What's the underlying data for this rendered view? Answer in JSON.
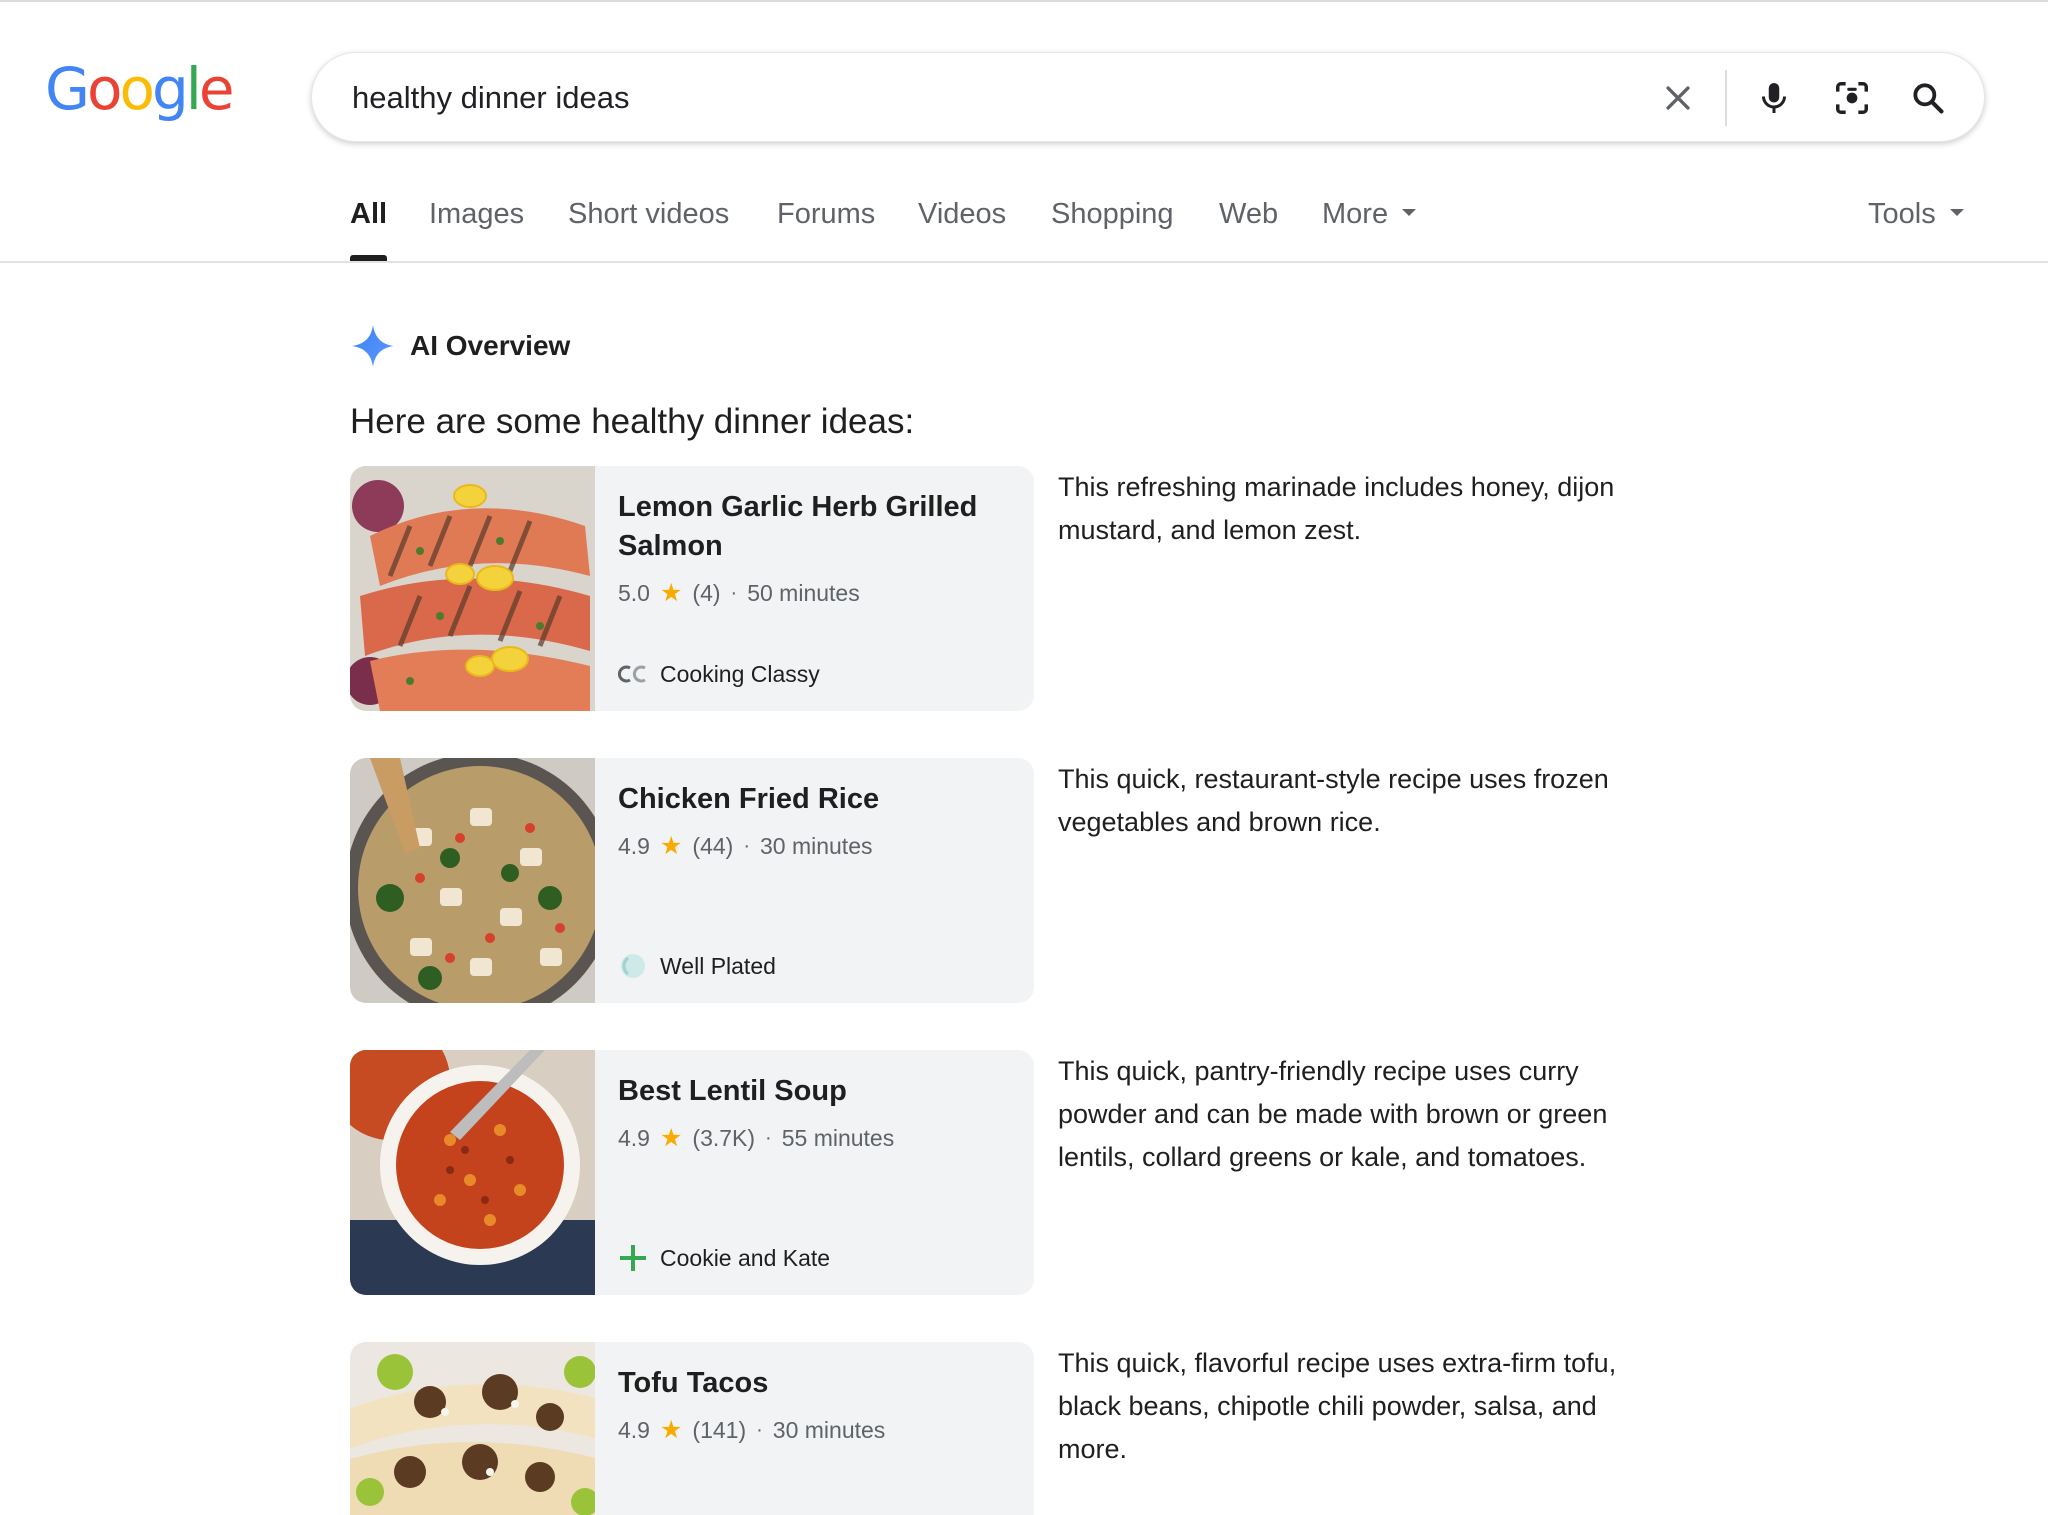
{
  "logo": {
    "letters": [
      "G",
      "o",
      "o",
      "g",
      "l",
      "e"
    ],
    "colors": [
      "#4285f4",
      "#ea4335",
      "#fbbc05",
      "#4285f4",
      "#34a853",
      "#ea4335"
    ]
  },
  "search": {
    "query": "healthy dinner ideas",
    "icons": [
      "close-icon",
      "mic-icon",
      "lens-icon",
      "search-icon"
    ]
  },
  "tabs": [
    {
      "label": "All",
      "active": true
    },
    {
      "label": "Images"
    },
    {
      "label": "Short videos"
    },
    {
      "label": "Forums"
    },
    {
      "label": "Videos"
    },
    {
      "label": "Shopping"
    },
    {
      "label": "Web"
    },
    {
      "label": "More",
      "dropdown": true
    }
  ],
  "tools": {
    "label": "Tools"
  },
  "ai_overview": {
    "label": "AI Overview",
    "intro": "Here are some healthy dinner ideas:",
    "recipes": [
      {
        "title": "Lemon Garlic Herb Grilled Salmon",
        "rating": "5.0",
        "reviews": "(4)",
        "time": "50 minutes",
        "source": "Cooking Classy",
        "source_icon": "cooking-classy-logo",
        "description": "This refreshing marinade includes honey, dijon mustard, and lemon zest."
      },
      {
        "title": "Chicken Fried Rice",
        "rating": "4.9",
        "reviews": "(44)",
        "time": "30 minutes",
        "source": "Well Plated",
        "source_icon": "well-plated-logo",
        "description": "This quick, restaurant-style recipe uses frozen vegetables and brown rice."
      },
      {
        "title": "Best Lentil Soup",
        "rating": "4.9",
        "reviews": "(3.7K)",
        "time": "55 minutes",
        "source": "Cookie and Kate",
        "source_icon": "cookie-and-kate-logo",
        "description": "This quick, pantry-friendly recipe uses curry powder and can be made with brown or green lentils, collard greens or kale, and tomatoes."
      },
      {
        "title": "Tofu Tacos",
        "rating": "4.9",
        "reviews": "(141)",
        "time": "30 minutes",
        "source": "",
        "source_icon": "",
        "description": "This quick, flavorful recipe uses extra-firm tofu, black beans, chipotle chili powder, salsa, and more."
      }
    ]
  },
  "colors": {
    "star": "#f9ab00",
    "ai_sparkle": "#4c8df6",
    "card_bg": "#f1f3f4",
    "muted_text": "#5f6368"
  }
}
